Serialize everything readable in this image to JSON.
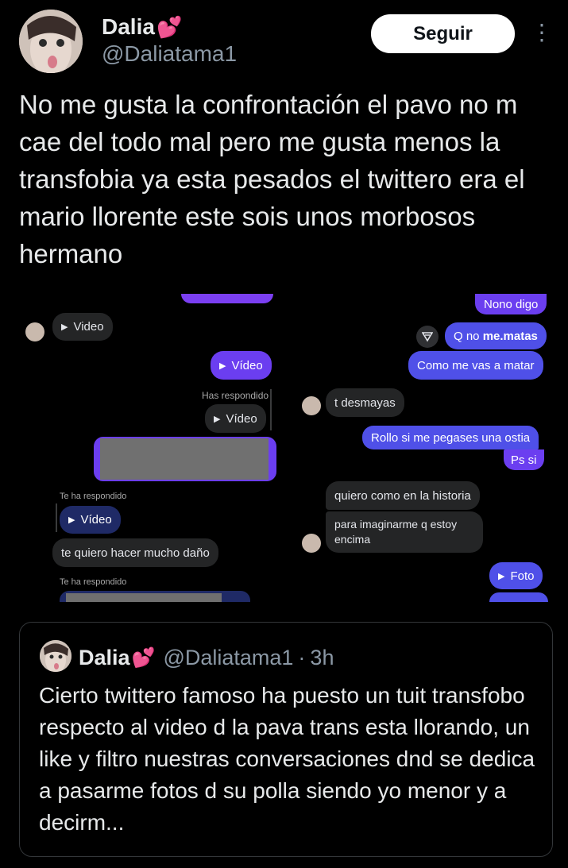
{
  "tweet": {
    "author_name": "Dalia",
    "author_emoji": "💕",
    "author_handle": "@Daliatama1",
    "follow_label": "Seguir",
    "more_label": "⋮",
    "text": "No me gusta la confrontación el pavo no m cae del todo mal pero me gusta menos la transfobia ya esta pesados el twittero era el mario llorente este sois unos morbosos hermano"
  },
  "chat_left": {
    "video_label": "Video",
    "video_label_out": "Vídeo",
    "replied_label": "Has respondido",
    "video_label_2": "Vídeo",
    "te_ha_respondido_1": "Te ha respondido",
    "video_label_3": "Vídeo",
    "msg_1": "te quiero hacer mucho daño",
    "te_ha_respondido_2": "Te ha respondido"
  },
  "chat_right": {
    "msg_top": "Nono digo",
    "msg_q_prefix": "Q no ",
    "msg_q_bold": "me.matas",
    "msg_como": "Como me vas a matar",
    "msg_desmayas": "t desmayas",
    "msg_rollo": "Rollo si me pegases una ostia",
    "msg_ps": "Ps si",
    "msg_historia": "quiero como en la historia",
    "msg_imaginarme": "para imaginarme q estoy encima",
    "foto_label": "Foto"
  },
  "quote": {
    "author_name": "Dalia",
    "author_emoji": "💕",
    "author_handle": "@Daliatama1",
    "separator": "·",
    "time": "3h",
    "text": "Cierto twittero famoso ha puesto un tuit transfobo respecto al video d la pava trans esta llorando, un like y filtro nuestras conversaciones dnd se dedica a pasarme fotos d su polla siendo yo menor y a decirm..."
  },
  "colors": {
    "background": "#000000",
    "accent_purple": "#6b3ef0",
    "accent_blue": "#4f50e8",
    "incoming_bubble": "#242526"
  }
}
